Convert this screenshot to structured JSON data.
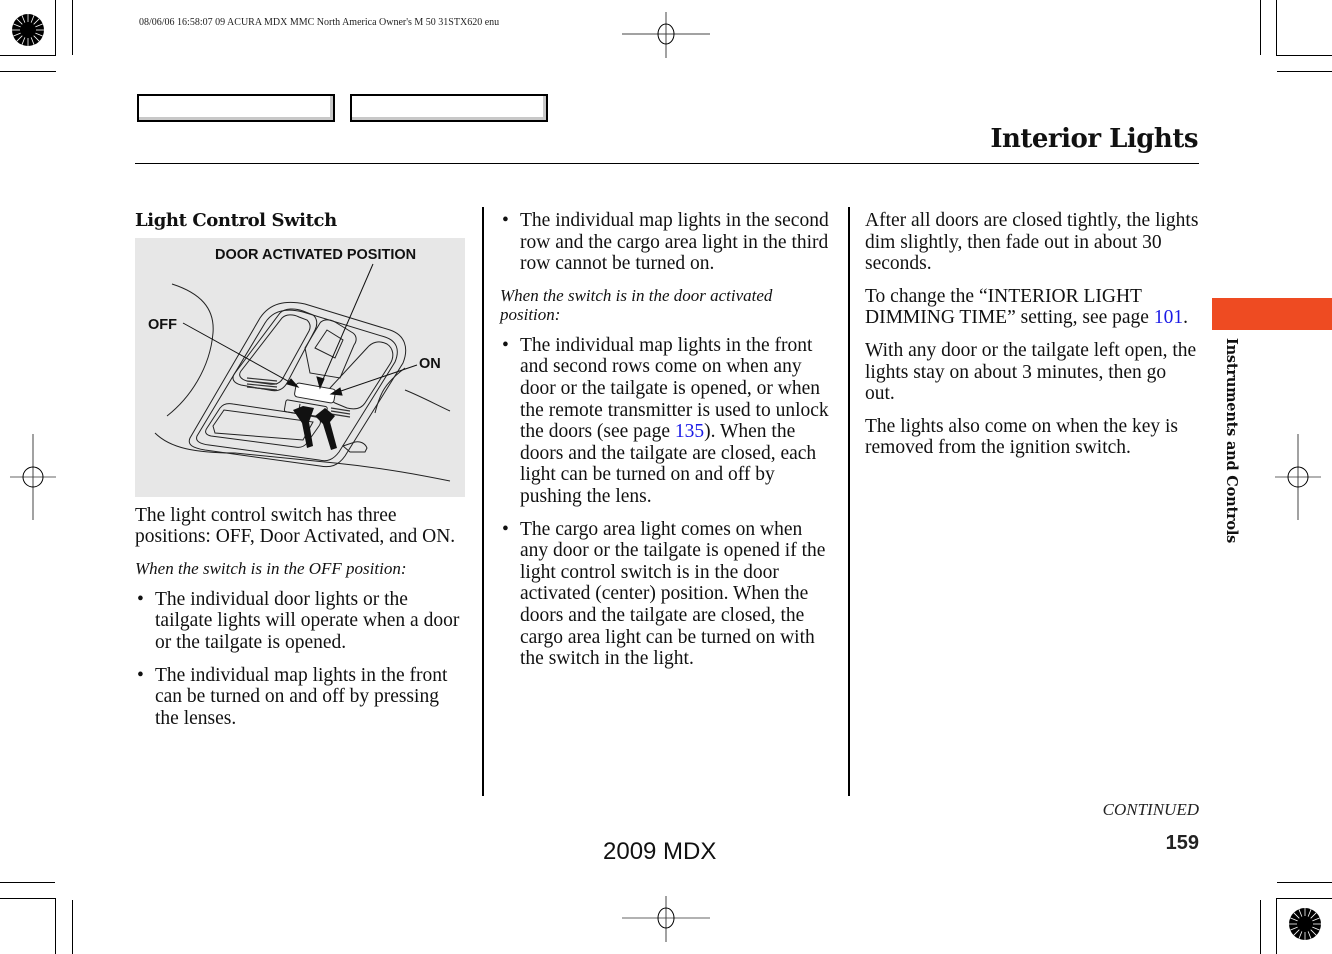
{
  "print_metadata": "08/06/06 16:58:07    09 ACURA MDX MMC North America Owner's M 50 31STX620 enu",
  "page_title": "Interior Lights",
  "side_tab": {
    "label": "Instruments and Controls",
    "color": "#ee4b22"
  },
  "column1": {
    "heading": "Light Control Switch",
    "figure": {
      "labels": {
        "door_activated": "DOOR ACTIVATED POSITION",
        "off": "OFF",
        "on": "ON"
      }
    },
    "intro": "The light control switch has three positions: OFF, Door Activated, and ON.",
    "off_position_heading": "When the switch is in the OFF position:",
    "off_bullets": [
      "The individual door lights or the tailgate lights will operate when a door or the tailgate is opened.",
      "The individual map lights in the front can be turned on and off by pressing the lenses."
    ]
  },
  "column2": {
    "bullet_top": "The individual map lights in the second row and the cargo area light in the third row cannot be turned on.",
    "door_position_heading": "When the switch is in the door activated position:",
    "door_bullet_1": {
      "before_link": "The individual map lights in the front and second rows come on when any door or the tailgate is opened, or when the remote transmitter is used to unlock the doors (see page ",
      "link": "135",
      "after_link": "). When the doors and the tailgate are closed, each light can be turned on and off by pushing the lens."
    },
    "door_bullet_2": "The cargo area light comes on when any door or the tailgate is opened if the light control switch is in the door activated (center) position. When the doors and the tailgate are closed, the cargo area light can be turned on with the switch in the light."
  },
  "column3": {
    "p1": "After all doors are closed tightly, the lights dim slightly, then fade out in about 30 seconds.",
    "p2_before_link": "To change the “INTERIOR LIGHT DIMMING TIME” setting, see page ",
    "p2_link": "101",
    "p2_after_link": ".",
    "p3": "With any door or the tailgate left open, the lights stay on about 3 minutes, then go out.",
    "p4": "The lights also come on when the key is removed from the ignition switch."
  },
  "footer": {
    "continued": "CONTINUED",
    "page_number": "159",
    "model": "2009  MDX"
  },
  "link_color": "#1a1ae6",
  "bullet_glyph": "•"
}
